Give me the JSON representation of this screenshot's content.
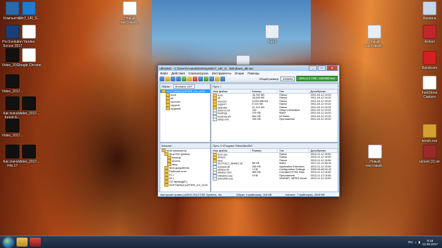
{
  "desktop_left": [
    {
      "label": "Компьютер",
      "icon": "computer-icon",
      "color": "#2b6aa8"
    },
    {
      "label": "Win7_UR_S...",
      "icon": "win-usb-icon",
      "color": "#1e7bd0"
    },
    {
      "label": "Pro Evolution Soccer 2017",
      "icon": "game-icon",
      "color": "#1a3e7a"
    },
    {
      "label": "Yandex",
      "icon": "yandex-icon",
      "color": "#ffffff"
    },
    {
      "label": "Video_2017...",
      "icon": "video-file-icon",
      "color": "#111111"
    },
    {
      "label": "Google Chrome",
      "icon": "chrome-icon",
      "color": "#ffffff"
    },
    {
      "label": "Video_2017...",
      "icon": "video-file-icon",
      "color": "#111111"
    },
    {
      "label": "Как скачать Kerish E...",
      "icon": "video-file-icon",
      "color": "#111111"
    },
    {
      "label": "Video_2017...",
      "icon": "video-file-icon",
      "color": "#111111"
    },
    {
      "label": "Video_2017...",
      "icon": "video-file-icon",
      "color": "#111111"
    },
    {
      "label": "Как скачать Fifa 17",
      "icon": "video-file-icon",
      "color": "#111111"
    },
    {
      "label": "Video_2017...",
      "icon": "video-file-icon",
      "color": "#111111"
    }
  ],
  "desktop_right": [
    {
      "label": "Новый текстовый...",
      "icon": "text-file-icon",
      "color": "#ffffff"
    },
    {
      "label": "Корзина",
      "icon": "recycle-bin-icon",
      "color": "#c7d6e6"
    },
    {
      "label": "Ashort",
      "icon": "app-icon",
      "color": "#c0272d"
    },
    {
      "label": "Bandicam",
      "icon": "bandicam-icon",
      "color": "#d32020"
    },
    {
      "label": "FastStone Capture",
      "icon": "capture-icon",
      "color": "#ffffff"
    },
    {
      "label": "kerish.exe",
      "icon": "exe-icon",
      "color": "#d4a030"
    },
    {
      "label": "ucnom (2).rar",
      "icon": "rar-icon",
      "color": "#9a2a2a"
    },
    {
      "label": "Новый текстовый...",
      "icon": "text-file-icon",
      "color": "#ffffff"
    }
  ],
  "desktop_center": [
    {
      "label": "Файл",
      "icon": "document-icon"
    },
    {
      "label": "Новый текстовый...",
      "icon": "text-file-icon"
    },
    {
      "label": "Новый текстовый...",
      "icon": "text-file-icon"
    }
  ],
  "window": {
    "title": "UltraISO - C:\\Users\\Алина\\Desktop\\Win7_UR_S...\\Windows_ultr.iso",
    "menu": [
      "Файл",
      "Действия",
      "Самозагрузка",
      "Инструменты",
      "Опции",
      "Помощь"
    ],
    "image_size_label": "Общий размер:",
    "image_size_value": "3068MB",
    "progress_text": "98% of 4.7GB - 1567MB free",
    "image_pane_header": {
      "label": "Образ:",
      "type": "Bootable UDF",
      "path_label": "Путь: /"
    },
    "tree": [
      "SOFTWIN(C)UFFER_UX_DVD",
      "boot",
      "efi",
      "sources",
      "support",
      "upgrade"
    ],
    "columns": [
      "Имя файла",
      "Размер",
      "Тип",
      "Дата/Время"
    ],
    "image_files": [
      {
        "name": "boot",
        "size": "16,240 KB",
        "type": "Папка",
        "date": "2011-04-12 19:20"
      },
      {
        "name": "efi",
        "size": "15,639 KB",
        "type": "Папка",
        "date": "2011-04-12 19:20"
      },
      {
        "name": "sources",
        "size": "3,033,396 KB",
        "type": "Папка",
        "date": "2011-04-12 19:20"
      },
      {
        "name": "support",
        "size": "9,124 KB",
        "type": "Папка",
        "date": "2011-04-12 19:20"
      },
      {
        "name": "upgrade",
        "size": "47,121 KB",
        "type": "Папка",
        "date": "2011-04-12 19:20"
      },
      {
        "name": "autorun.inf",
        "size": "122",
        "type": "Setup Information",
        "date": "2011-04-12 19:20"
      },
      {
        "name": "bootmgr",
        "size": "375 KB",
        "type": "Файл",
        "date": "2011-04-12 19:20"
      },
      {
        "name": "bootmgr.efi",
        "size": "654 KB",
        "type": "efi Файл",
        "date": "2011-04-12 19:20"
      },
      {
        "name": "setup.exe",
        "size": "105 KB",
        "type": "Приложение",
        "date": "2011-04-12 19:20"
      }
    ],
    "local_pane_header": {
      "label": "Каталог:",
      "path_label": "Путь: C:\\Program Files\\UltraISO"
    },
    "local_tree": [
      "Мой компьютер",
      "Мои ISO файлы",
      "backup",
      "drivers",
      "lang",
      "Мои документы",
      "Рабочий стол",
      "(C:)",
      "(D:)",
      "CD привод(E:)",
      "SOFTWIN(C)UFFER_UX_DVD"
    ],
    "local_files": [
      {
        "name": "boot.sys",
        "size": "",
        "type": "Папка",
        "date": "2013-11-12 15:50"
      },
      {
        "name": "drivers",
        "size": "",
        "type": "Папка",
        "date": "2013-11-12 15:50"
      },
      {
        "name": "lang",
        "size": "",
        "type": "Папка",
        "date": "2013-11-12 15:50"
      },
      {
        "name": "20170112_064407.txt",
        "size": "58 KB",
        "type": "Файл",
        "date": "2017-01-12 06:44"
      },
      {
        "name": "isoshell.dll",
        "size": "256 KB",
        "type": "Application Extension",
        "date": "2013-11-12 15:50"
      },
      {
        "name": "ultraiso.ini",
        "size": "1 KB",
        "type": "Configuration Settings",
        "date": "2009-06-08 04:40"
      },
      {
        "name": "ultraiso.chm",
        "size": "565 KB",
        "type": "Compiled HTML Help",
        "date": "2013-11-12 15:50"
      },
      {
        "name": "UltraISO.exe",
        "size": "5 KB",
        "type": "Приложение",
        "date": "2013-11-12 15:50"
      },
      {
        "name": "unins000.exe",
        "size": "",
        "type": "WinRAR...MPEG Movie",
        "date": "2013-11-12 15:50"
      }
    ],
    "status": [
      "Авторские права (c)2002-2012 EZB Systems, Inc.",
      "Образ: 4 файла(ов), 118 КВ",
      "Каталог: 7 файла(ов), 2628 КВ"
    ]
  },
  "taskbar": {
    "items": [
      "explorer-icon",
      "media-icon"
    ],
    "lang": "RU",
    "time": "8:18",
    "date": "12.05.2017"
  }
}
